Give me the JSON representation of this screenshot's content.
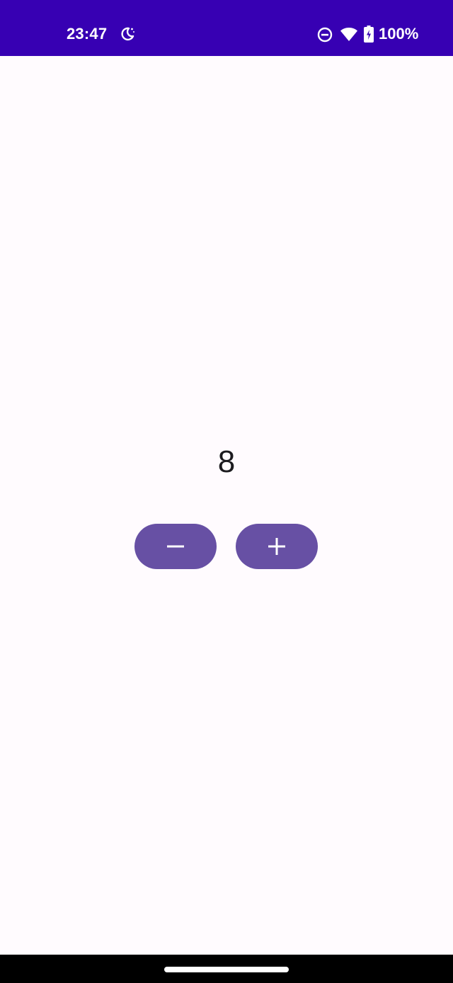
{
  "status_bar": {
    "time": "23:47",
    "battery_percent": "100%",
    "icons": [
      "moon-icon",
      "do-not-disturb-icon",
      "wifi-icon",
      "battery-charging-icon"
    ],
    "background_color": "#3700b3"
  },
  "counter": {
    "value": "8"
  },
  "buttons": {
    "decrement_icon": "minus-icon",
    "increment_icon": "plus-icon",
    "color": "#6750a4"
  }
}
